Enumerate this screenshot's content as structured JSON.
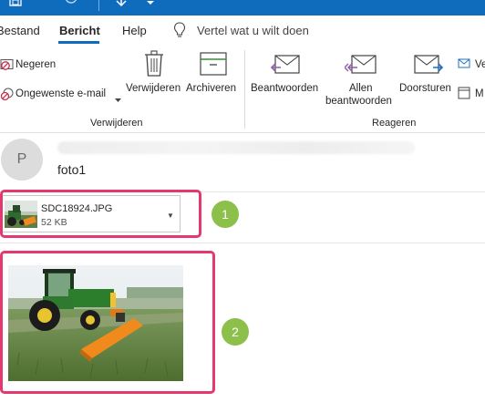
{
  "tabs": [
    {
      "label": "Bestand"
    },
    {
      "label": "Bericht"
    },
    {
      "label": "Help"
    }
  ],
  "tell_me": {
    "text": "Vertel wat u wilt doen"
  },
  "ribbon": {
    "verwijderen_group": {
      "label": "Verwijderen",
      "negeren": "Negeren",
      "ongewenste": "Ongewenste e-mail",
      "verwijderen": "Verwijderen",
      "archiveren": "Archiveren"
    },
    "reageren_group": {
      "label": "Reageren",
      "beantwoorden": "Beantwoorden",
      "allen_line1": "Allen",
      "allen_line2": "beantwoorden",
      "doorsturen": "Doorsturen",
      "partial_1": "Ve",
      "partial_2": "M"
    }
  },
  "message": {
    "avatar_initial": "P",
    "subject": "foto1"
  },
  "attachment": {
    "name": "SDC18924.JPG",
    "size": "52 KB"
  },
  "annotations": [
    {
      "number": "1"
    },
    {
      "number": "2"
    }
  ],
  "colors": {
    "brand": "#0f6cbd",
    "highlight": "#e5386f",
    "badge": "#8dbf4b",
    "reply_purple": "#8e5ea8"
  },
  "icons": [
    "save-icon",
    "undo-icon",
    "redo-icon",
    "arrow-down-icon",
    "lightbulb-icon",
    "ignore-icon",
    "junk-icon",
    "trash-icon",
    "archive-icon",
    "reply-icon",
    "reply-all-icon",
    "forward-icon"
  ]
}
